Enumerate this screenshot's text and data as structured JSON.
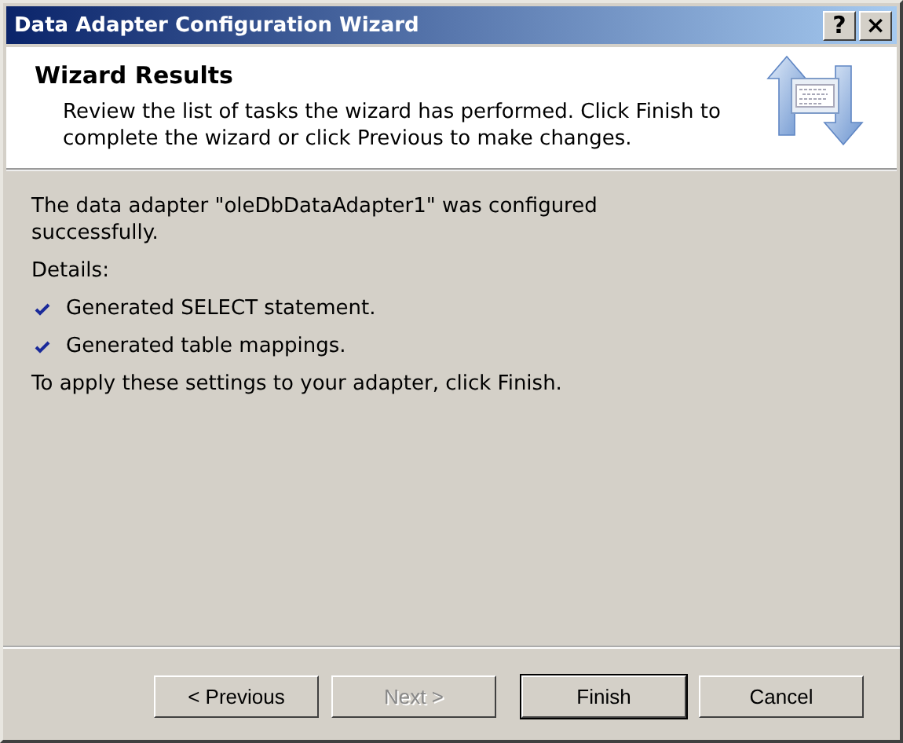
{
  "window": {
    "title": "Data Adapter Configuration Wizard",
    "caption_buttons": [
      "?",
      "×"
    ]
  },
  "header": {
    "title": "Wizard Results",
    "description": "Review the list of tasks the wizard has performed. Click Finish to complete the wizard or click Previous to make changes."
  },
  "body": {
    "message": "The data adapter \"oleDbDataAdapter1\" was configured successfully.",
    "details_label": "Details:",
    "details": [
      {
        "text": "Generated SELECT statement.",
        "checked": true
      },
      {
        "text": "Generated table mappings.",
        "checked": true
      }
    ],
    "footer_note": "To apply these settings to your adapter, click Finish."
  },
  "buttons": [
    {
      "label": "< Previous",
      "disabled": false,
      "default": false
    },
    {
      "label": "Next >",
      "disabled": true,
      "default": false
    },
    {
      "label": "Finish",
      "disabled": false,
      "default": true
    },
    {
      "label": "Cancel",
      "disabled": false,
      "default": false
    }
  ]
}
